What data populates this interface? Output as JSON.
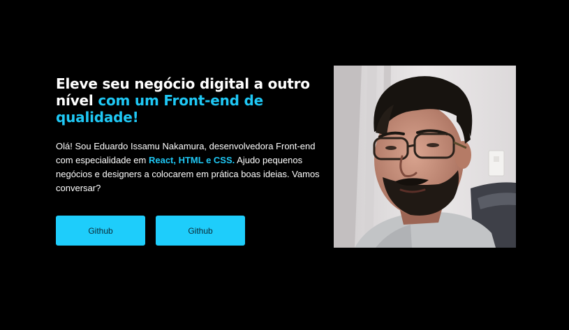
{
  "hero": {
    "headline_white": "Eleve seu negócio digital a outro nível ",
    "headline_accent": "com um Front-end de qualidade!",
    "intro_start": "Olá! Sou Eduardo Issamu Nakamura, desenvolvedora Front-end com especialidade em ",
    "intro_tech": "React, HTML e CSS.",
    "intro_end": " Ajudo pequenos negócios e designers a colocarem em prática boas ideias. Vamos conversar?"
  },
  "buttons": [
    {
      "label": "Github"
    },
    {
      "label": "Github"
    }
  ],
  "colors": {
    "background": "#000000",
    "accent": "#1fc8f5",
    "button_bg": "#1ecdfb",
    "button_text": "#0b2a36"
  }
}
